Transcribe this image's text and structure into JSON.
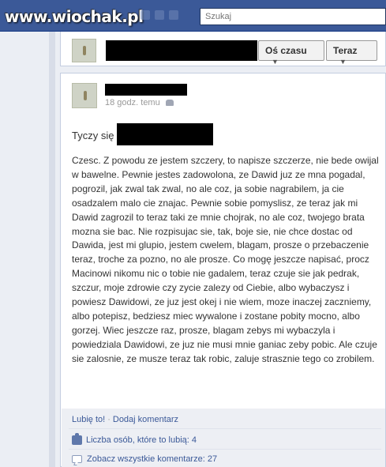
{
  "topbar": {
    "logo_text": "www.wiochak.pl",
    "search_placeholder": "Szukaj"
  },
  "header": {
    "filter_button": "Oś czasu",
    "time_button": "Teraz"
  },
  "post": {
    "timestamp": "18 godz. temu",
    "tagged_label": "Tyczy się",
    "body": "Czesc. Z powodu ze jestem szczery, to napisze szczerze, nie bede owijal w bawelne. Pewnie jestes zadowolona, ze Dawid juz ze mna pogadal, pogrozil, jak zwal tak zwal, no ale coz, ja sobie nagrabilem, ja cie osadzalem malo cie znajac. Pewnie sobie pomyslisz, ze teraz jak mi Dawid zagrozil to teraz taki ze mnie chojrak, no ale coz, twojego brata mozna sie bac. Nie rozpisujac sie, tak, boje sie, nie chce dostac od Dawida, jest mi glupio, jestem cwelem, blagam, prosze o przebaczenie teraz, troche za pozno, no ale prosze. Co mogę jeszcze napisać, procz Macinowi nikomu nic o tobie nie gadalem, teraz czuje sie jak pedrak, szczur, moje zdrowie czy zycie zalezy od Ciebie, albo wybaczysz i powiesz Dawidowi, ze juz jest okej i nie wiem, moze inaczej zaczniemy, albo potepisz, bedziesz miec wywalone i zostane pobity mocno, albo gorzej. Wiec jeszcze raz, prosze, blagam zebys mi wybaczyla i powiedziala Dawidowi, ze juz nie musi mnie ganiac zeby pobic. Ale czuje sie zalosnie, ze musze teraz tak robic, zaluje strasznie tego co zrobilem."
  },
  "actions": {
    "like_link": "Lubię to!",
    "separator": "·",
    "comment_link": "Dodaj komentarz",
    "likes_label": "Liczba osób, które to lubią:",
    "likes_count": "4",
    "comments_label": "Zobacz wszystkie komentarze:",
    "comments_count": "27"
  }
}
